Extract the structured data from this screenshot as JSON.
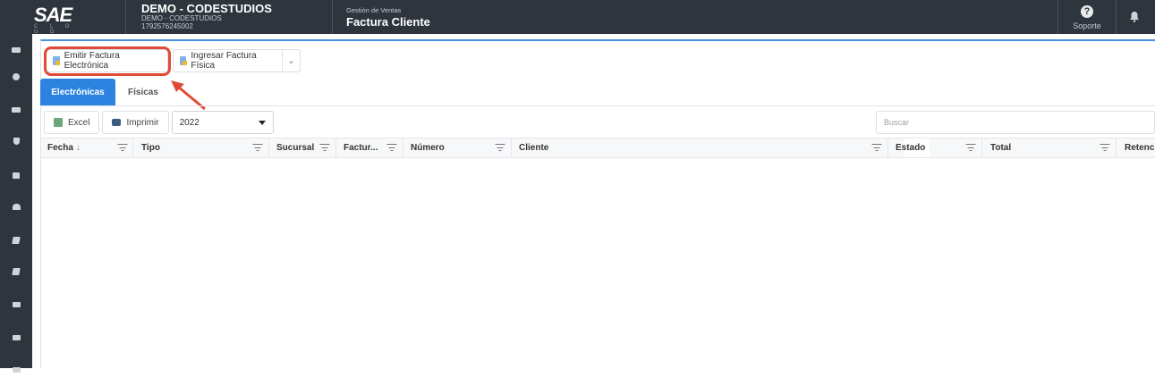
{
  "header": {
    "logo_text": "SAE",
    "logo_sub": "C L O U D",
    "company_name": "DEMO - CODESTUDIOS",
    "company_sub": "DEMO - CODESTUDIOS",
    "company_ruc": "1792576245002",
    "module_crumb": "Gestión de Ventas",
    "module_title": "Factura Cliente",
    "support_label": "Soporte",
    "support_glyph": "?"
  },
  "sidebar": {
    "icons": [
      "menu-icon",
      "chart-icon",
      "card-icon",
      "shield-icon",
      "cart-icon",
      "user-icon",
      "book-icon",
      "book-icon",
      "list-icon",
      "list-icon",
      "list-icon"
    ]
  },
  "toolbar": {
    "emit_label": "Emitir Factura Electrónica",
    "ingress_label": "Ingresar Factura Física",
    "dropdown_glyph": "⌄"
  },
  "tabs": [
    {
      "label": "Electrónicas",
      "active": true
    },
    {
      "label": "Físicas",
      "active": false
    }
  ],
  "filters": {
    "excel_label": "Excel",
    "print_label": "Imprimir",
    "year_value": "2022",
    "search_placeholder": "Buscar"
  },
  "grid": {
    "columns": [
      "Fecha",
      "Tipo",
      "Sucursal",
      "Factur...",
      "Número",
      "Cliente",
      "Estado",
      "Total",
      "Retenci"
    ],
    "sort_glyph": "↓"
  },
  "colors": {
    "accent": "#2d84e0",
    "topbar": "#2e353d",
    "highlight": "#e04b36"
  }
}
